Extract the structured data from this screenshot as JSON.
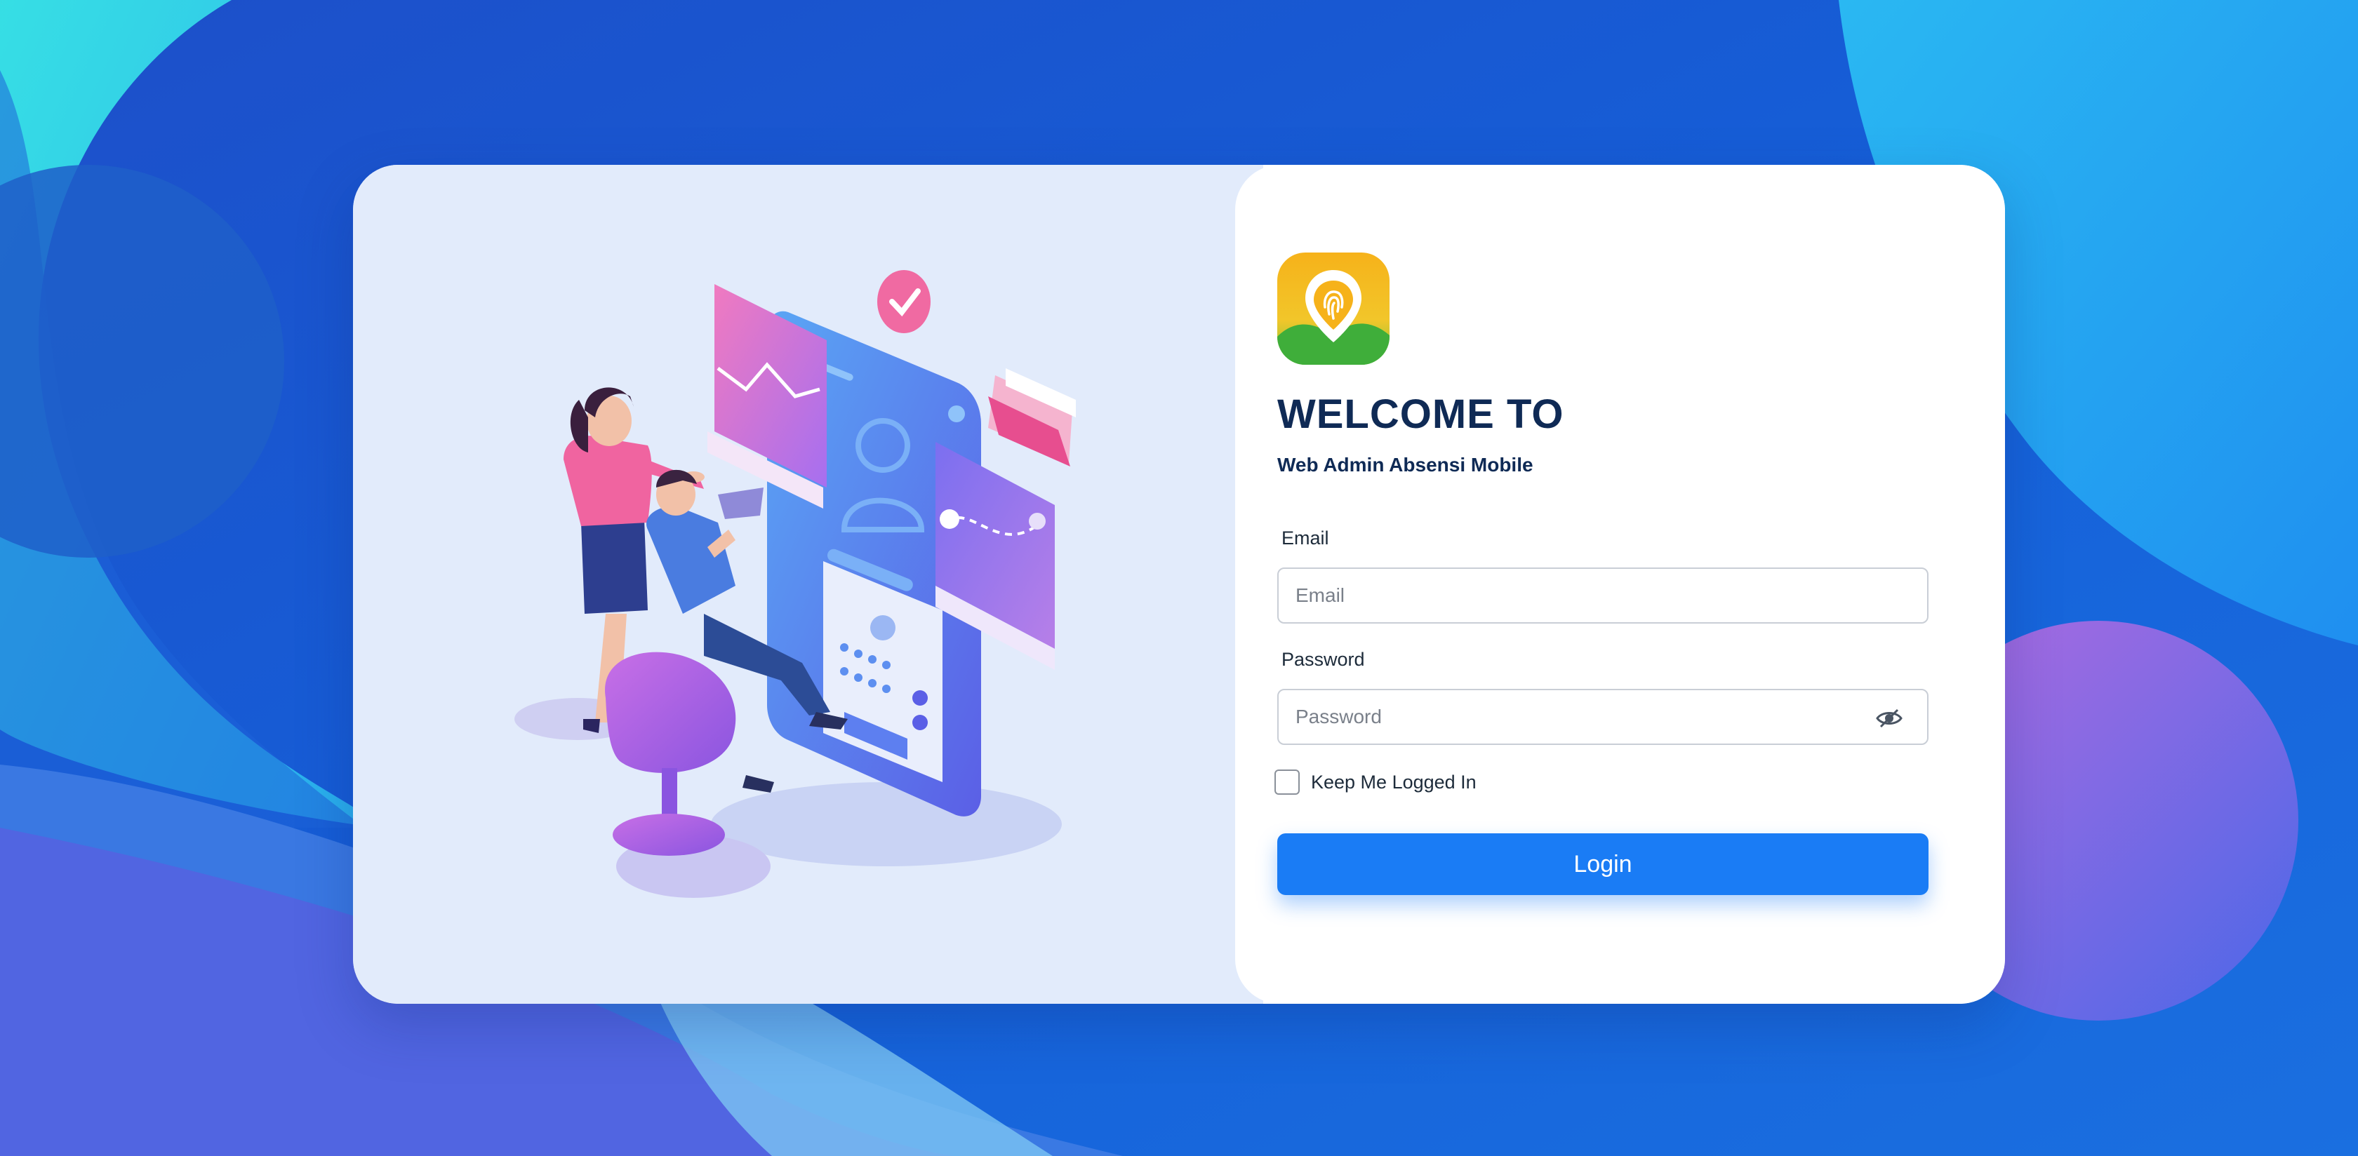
{
  "app": {
    "title": "WELCOME TO",
    "subtitle": "Web Admin Absensi Mobile",
    "logo_icon": "fingerprint-location-icon"
  },
  "form": {
    "email_label": "Email",
    "email_placeholder": "Email",
    "email_value": "",
    "password_label": "Password",
    "password_placeholder": "Password",
    "password_value": "",
    "password_toggle_icon": "eye-slash-icon",
    "remember_label": "Keep Me Logged In",
    "remember_checked": false,
    "login_label": "Login"
  },
  "colors": {
    "background": "#1a5fd6",
    "accent": "#1a7cf5",
    "title": "#0f2a55",
    "illustration_bg": "#e2ebfb"
  },
  "illustration": {
    "name": "team-working-with-phone-illustration"
  }
}
